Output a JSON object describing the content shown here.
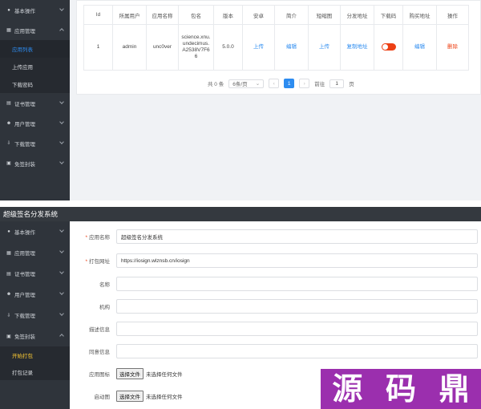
{
  "panel1": {
    "sidebar": {
      "items": [
        {
          "label": "基本操作",
          "icon": "user-icon"
        },
        {
          "label": "应用管理",
          "icon": "layers-icon",
          "expanded": true,
          "children": [
            {
              "label": "应用列表",
              "active": true
            },
            {
              "label": "上传应用"
            },
            {
              "label": "下载密码"
            }
          ]
        },
        {
          "label": "证书管理",
          "icon": "certificate-icon"
        },
        {
          "label": "用户管理",
          "icon": "users-icon"
        },
        {
          "label": "下载管理",
          "icon": "download-icon"
        },
        {
          "label": "免签封装",
          "icon": "package-icon"
        }
      ]
    },
    "table": {
      "headers": [
        "Id",
        "所属用户",
        "应用名称",
        "包名",
        "版本",
        "安卓",
        "简介",
        "短缩图",
        "分发地址",
        "下载码",
        "购买地址",
        "操作"
      ],
      "rows": [
        {
          "id": "1",
          "user": "admin",
          "app_name": "unc0ver",
          "package": "science.xnu.undecimus.A2538V7F66",
          "version": "5.0.0",
          "android": "上传",
          "intro": "编辑",
          "thumb": "上传",
          "dist": "复制地址",
          "download_code_on": true,
          "buy": "编辑",
          "action": "删除"
        }
      ]
    },
    "pager": {
      "total": "共 0 条",
      "page_size": "6条/页",
      "prev": "‹",
      "current": "1",
      "next": "›",
      "goto_label": "前往",
      "goto_value": "1",
      "page_suffix": "页"
    }
  },
  "panel2": {
    "title": "超级签名分发系统",
    "sidebar": {
      "items": [
        {
          "label": "基本操作",
          "icon": "user-icon"
        },
        {
          "label": "应用管理",
          "icon": "layers-icon"
        },
        {
          "label": "证书管理",
          "icon": "certificate-icon"
        },
        {
          "label": "用户管理",
          "icon": "users-icon"
        },
        {
          "label": "下载管理",
          "icon": "download-icon"
        },
        {
          "label": "免签封装",
          "icon": "package-icon",
          "expanded": true,
          "children": [
            {
              "label": "开始打包",
              "active": true
            },
            {
              "label": "打包记录"
            }
          ]
        }
      ]
    },
    "form": {
      "fields": [
        {
          "label": "应用名称",
          "required": true,
          "value": "超级签名分发系统",
          "type": "text"
        },
        {
          "label": "打包网址",
          "required": true,
          "value": "https://iosign.wlznsb.cn/iosign",
          "type": "text"
        },
        {
          "label": "名称",
          "required": false,
          "value": "",
          "type": "text"
        },
        {
          "label": "机构",
          "required": false,
          "value": "",
          "type": "text"
        },
        {
          "label": "描述信息",
          "required": false,
          "value": "",
          "type": "text"
        },
        {
          "label": "同意信息",
          "required": false,
          "value": "",
          "type": "text"
        },
        {
          "label": "应用图标",
          "required": false,
          "type": "file",
          "button": "选择文件",
          "status": "未选择任何文件"
        },
        {
          "label": "启动图",
          "required": false,
          "type": "file",
          "button": "选择文件",
          "status": "未选择任何文件"
        }
      ]
    },
    "watermark": [
      "源",
      "码",
      "鼎"
    ]
  },
  "colors": {
    "sidebar_bg": "#2f343b",
    "accent_blue": "#2d8cf0",
    "danger_red": "#ed4014",
    "active_yellow": "#ffcc33",
    "watermark_purple": "#9b2fae"
  }
}
